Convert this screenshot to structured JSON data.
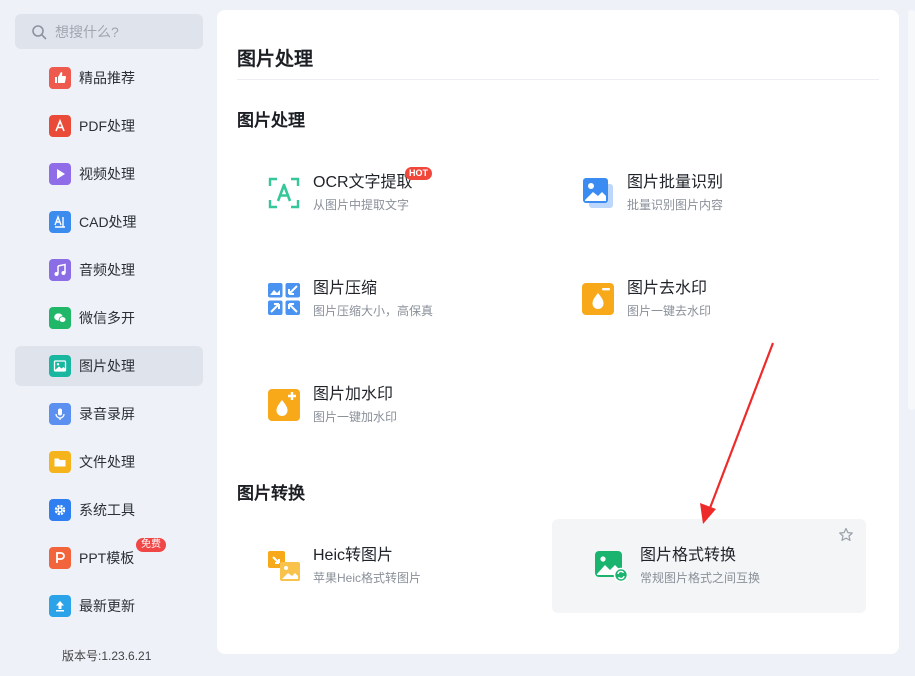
{
  "search": {
    "placeholder": "想搜什么?"
  },
  "sidebar": {
    "items": [
      {
        "label": "精品推荐",
        "icon": "thumbs-up-icon",
        "color": "#ee5a4d"
      },
      {
        "label": "PDF处理",
        "icon": "pdf-icon",
        "color": "#ea4b39"
      },
      {
        "label": "视频处理",
        "icon": "play-icon",
        "color": "#8f6ce8"
      },
      {
        "label": "CAD处理",
        "icon": "cad-icon",
        "color": "#3c8cf0"
      },
      {
        "label": "音频处理",
        "icon": "music-icon",
        "color": "#8b6ee6"
      },
      {
        "label": "微信多开",
        "icon": "wechat-icon",
        "color": "#21b768"
      },
      {
        "label": "图片处理",
        "icon": "image-icon",
        "color": "#19b7a0"
      },
      {
        "label": "录音录屏",
        "icon": "microphone-icon",
        "color": "#5b8ff0"
      },
      {
        "label": "文件处理",
        "icon": "folder-icon",
        "color": "#f6b41c"
      },
      {
        "label": "系统工具",
        "icon": "gear-icon",
        "color": "#2f7ff0"
      },
      {
        "label": "PPT模板",
        "icon": "ppt-icon",
        "color": "#f2653c",
        "badge": "免费"
      },
      {
        "label": "最新更新",
        "icon": "upload-icon",
        "color": "#2aa3e8"
      }
    ],
    "active_index": 6,
    "version": "版本号:1.23.6.21"
  },
  "main": {
    "title": "图片处理",
    "sections": [
      {
        "title": "图片处理",
        "tools": [
          {
            "name": "OCR文字提取",
            "desc": "从图片中提取文字",
            "badge": "HOT",
            "icon": "ocr-icon"
          },
          {
            "name": "图片批量识别",
            "desc": "批量识别图片内容",
            "icon": "batch-image-icon"
          },
          {
            "name": "图片压缩",
            "desc": "图片压缩大小，高保真",
            "icon": "compress-icon"
          },
          {
            "name": "图片去水印",
            "desc": "图片一键去水印",
            "icon": "remove-watermark-icon"
          },
          {
            "name": "图片加水印",
            "desc": "图片一键加水印",
            "icon": "add-watermark-icon"
          }
        ]
      },
      {
        "title": "图片转换",
        "tools": [
          {
            "name": "Heic转图片",
            "desc": "苹果Heic格式转图片",
            "icon": "heic-icon"
          },
          {
            "name": "图片格式转换",
            "desc": "常规图片格式之间互换",
            "icon": "format-convert-icon"
          }
        ]
      }
    ]
  },
  "colors": {
    "accent_red": "#f0473a",
    "background": "#eef2f8",
    "panel": "#ffffff"
  }
}
